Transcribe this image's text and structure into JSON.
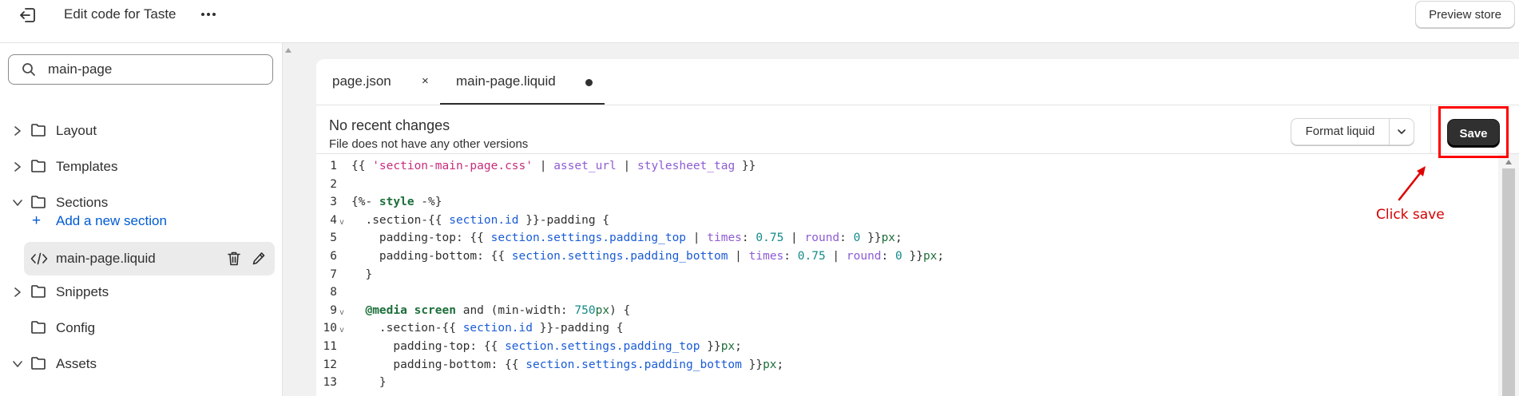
{
  "topbar": {
    "exit_icon": "exit-icon",
    "title": "Edit code for Taste",
    "more_icon": "ellipsis-icon",
    "preview_label": "Preview store"
  },
  "sidebar": {
    "search": {
      "value": "main-page",
      "icon": "search-icon"
    },
    "items": [
      {
        "label": "Layout",
        "state": "collapsed",
        "icon": "folder-icon"
      },
      {
        "label": "Templates",
        "state": "collapsed",
        "icon": "folder-icon"
      },
      {
        "label": "Sections",
        "state": "expanded",
        "icon": "folder-icon"
      },
      {
        "label": "Snippets",
        "state": "collapsed",
        "icon": "folder-icon"
      },
      {
        "label": "Config",
        "state": "none",
        "icon": "folder-icon"
      },
      {
        "label": "Assets",
        "state": "expanded",
        "icon": "folder-icon"
      }
    ],
    "add_section": {
      "plus": "+",
      "label": "Add a new section"
    },
    "active_file": {
      "label": "main-page.liquid",
      "icon": "code-icon"
    }
  },
  "tabs": [
    {
      "label": "page.json",
      "close": "×"
    },
    {
      "label": "main-page.liquid",
      "unsaved": true
    }
  ],
  "status": {
    "title": "No recent changes",
    "subtitle": "File does not have any other versions"
  },
  "format": {
    "label": "Format liquid"
  },
  "save": {
    "label": "Save"
  },
  "annotation": {
    "text": "Click save"
  },
  "code": {
    "line_numbers": [
      "1",
      "2",
      "3",
      "4",
      "5",
      "6",
      "7",
      "8",
      "9",
      "10",
      "11",
      "12",
      "13"
    ],
    "fold_lines": [
      "4",
      "9",
      "10"
    ],
    "lines": [
      [
        [
          "t-plain",
          "{{ "
        ],
        [
          "t-str",
          "'section-main-page.css'"
        ],
        [
          "t-plain",
          " | "
        ],
        [
          "t-fil",
          "asset_url"
        ],
        [
          "t-plain",
          " | "
        ],
        [
          "t-fil",
          "stylesheet_tag"
        ],
        [
          "t-plain",
          " }}"
        ]
      ],
      [],
      [
        [
          "t-plain",
          "{%- "
        ],
        [
          "t-kw",
          "style"
        ],
        [
          "t-plain",
          " -%}"
        ]
      ],
      [
        [
          "t-plain",
          "  .section-{{ "
        ],
        [
          "t-obj",
          "section.id"
        ],
        [
          "t-plain",
          " }}-padding {"
        ]
      ],
      [
        [
          "t-plain",
          "    padding-top: {{ "
        ],
        [
          "t-obj",
          "section.settings.padding_top"
        ],
        [
          "t-plain",
          " | "
        ],
        [
          "t-fil",
          "times"
        ],
        [
          "t-plain",
          ": "
        ],
        [
          "t-num",
          "0.75"
        ],
        [
          "t-plain",
          " | "
        ],
        [
          "t-fil",
          "round"
        ],
        [
          "t-plain",
          ": "
        ],
        [
          "t-num",
          "0"
        ],
        [
          "t-plain",
          " }}"
        ],
        [
          "t-unit",
          "px"
        ],
        [
          "t-plain",
          ";"
        ]
      ],
      [
        [
          "t-plain",
          "    padding-bottom: {{ "
        ],
        [
          "t-obj",
          "section.settings.padding_bottom"
        ],
        [
          "t-plain",
          " | "
        ],
        [
          "t-fil",
          "times"
        ],
        [
          "t-plain",
          ": "
        ],
        [
          "t-num",
          "0.75"
        ],
        [
          "t-plain",
          " | "
        ],
        [
          "t-fil",
          "round"
        ],
        [
          "t-plain",
          ": "
        ],
        [
          "t-num",
          "0"
        ],
        [
          "t-plain",
          " }}"
        ],
        [
          "t-unit",
          "px"
        ],
        [
          "t-plain",
          ";"
        ]
      ],
      [
        [
          "t-plain",
          "  }"
        ]
      ],
      [],
      [
        [
          "t-plain",
          "  "
        ],
        [
          "t-kw",
          "@media"
        ],
        [
          "t-plain",
          " "
        ],
        [
          "t-kw",
          "screen"
        ],
        [
          "t-plain",
          " and (min-width: "
        ],
        [
          "t-num",
          "750"
        ],
        [
          "t-unit",
          "px"
        ],
        [
          "t-plain",
          ") {"
        ]
      ],
      [
        [
          "t-plain",
          "    .section-{{ "
        ],
        [
          "t-obj",
          "section.id"
        ],
        [
          "t-plain",
          " }}-padding {"
        ]
      ],
      [
        [
          "t-plain",
          "      padding-top: {{ "
        ],
        [
          "t-obj",
          "section.settings.padding_top"
        ],
        [
          "t-plain",
          " }}"
        ],
        [
          "t-unit",
          "px"
        ],
        [
          "t-plain",
          ";"
        ]
      ],
      [
        [
          "t-plain",
          "      padding-bottom: {{ "
        ],
        [
          "t-obj",
          "section.settings.padding_bottom"
        ],
        [
          "t-plain",
          " }}"
        ],
        [
          "t-unit",
          "px"
        ],
        [
          "t-plain",
          ";"
        ]
      ],
      [
        [
          "t-plain",
          "    }"
        ]
      ]
    ]
  }
}
